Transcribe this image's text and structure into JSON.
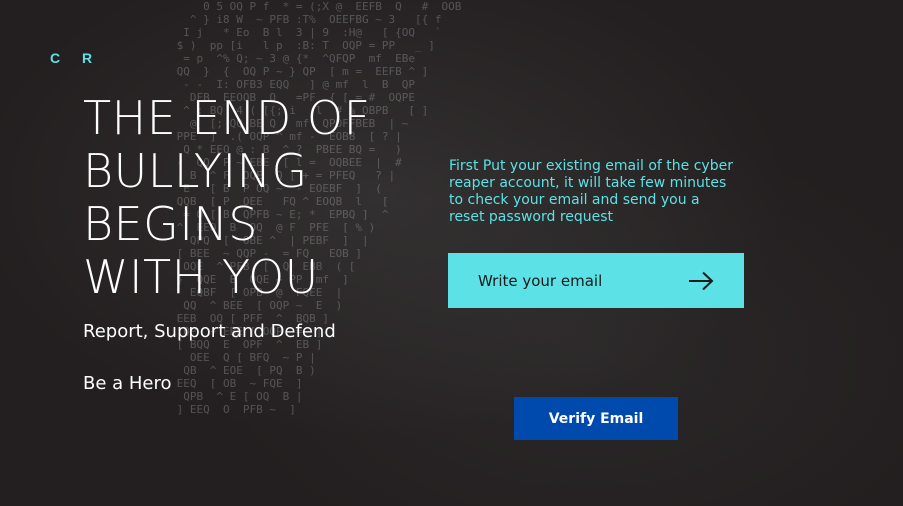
{
  "logo": {
    "text": "C R"
  },
  "hero": {
    "headline_lines": [
      "THE END OF",
      "BULLYING",
      "BEGINS",
      "WITH YOU"
    ],
    "tagline": "Report, Support and Defend",
    "call_to_action": "Be a Hero"
  },
  "reset_form": {
    "instructions": "First Put your existing email of the cyber reaper account, it will take few minutes to check your email and send you a reset password request",
    "email_placeholder": "Write your email",
    "submit_icon": "arrow-right-icon",
    "verify_label": "Verify Email"
  },
  "colors": {
    "background": "#231f20",
    "accent": "#5ce1e6",
    "button": "#004aad",
    "text": "#ffffff"
  }
}
